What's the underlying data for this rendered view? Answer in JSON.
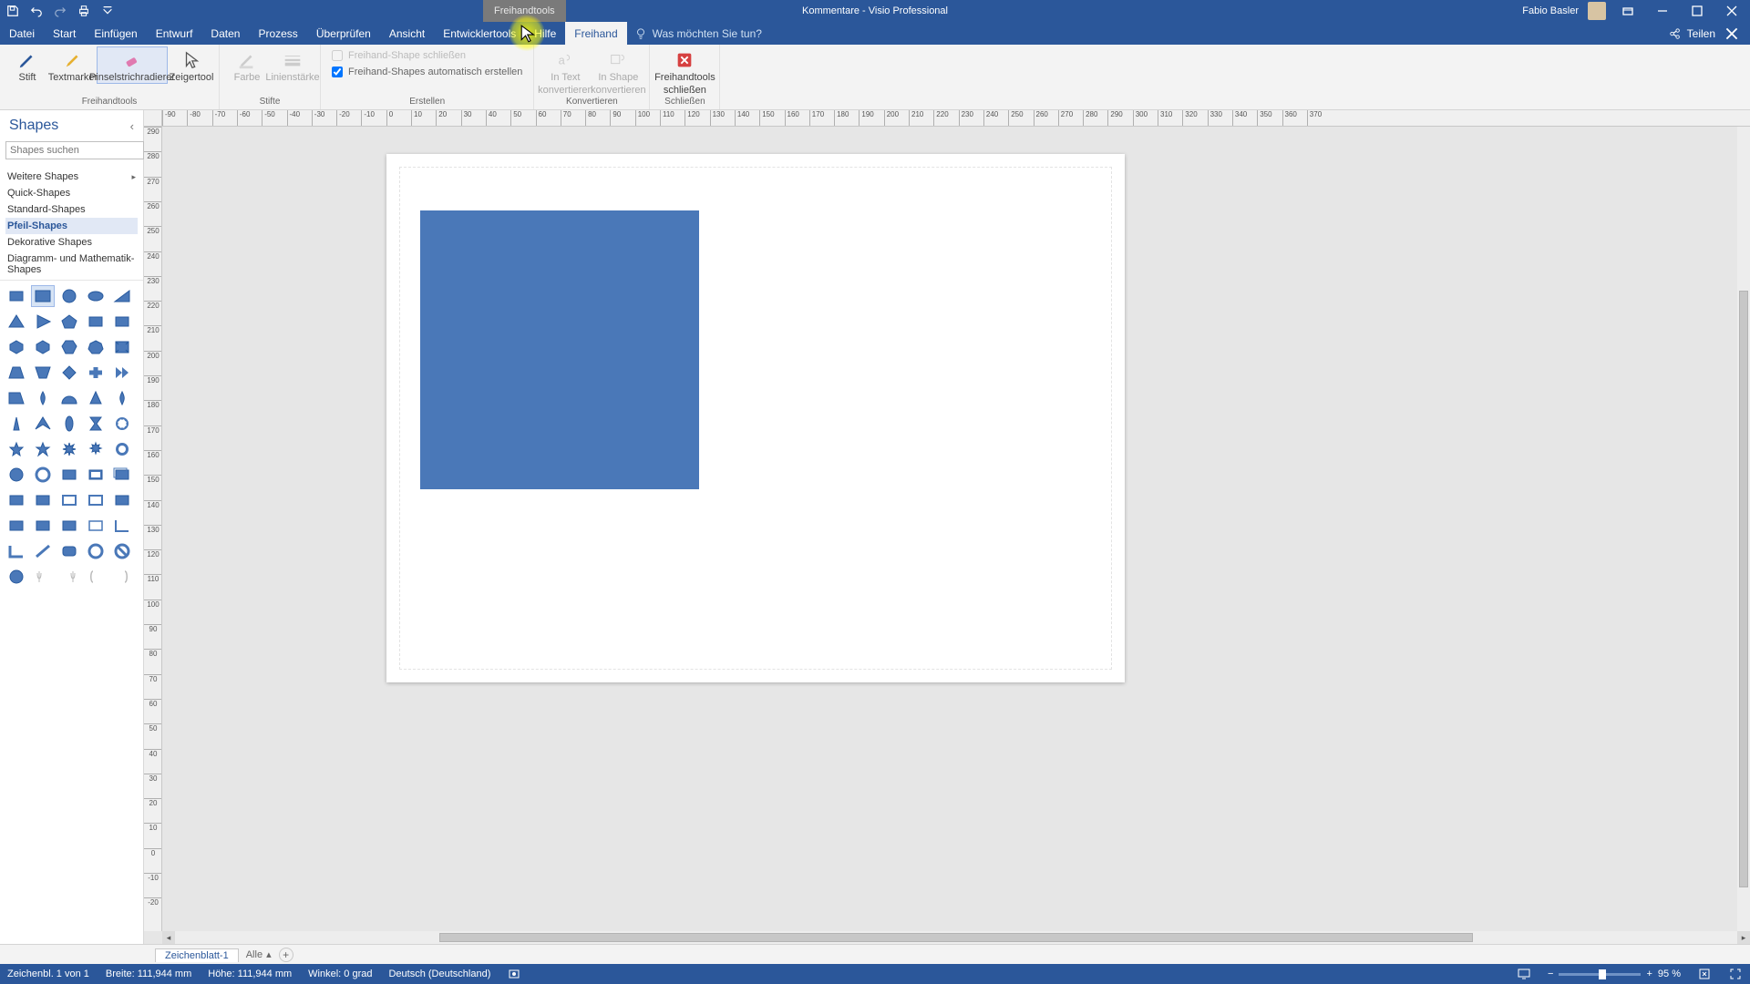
{
  "titlebar": {
    "context_tab": "Freihandtools",
    "doc": "Kommentare  -  Visio Professional",
    "user": "Fabio Basler"
  },
  "menu": {
    "tabs": [
      "Datei",
      "Start",
      "Einfügen",
      "Entwurf",
      "Daten",
      "Prozess",
      "Überprüfen",
      "Ansicht",
      "Entwicklertools",
      "Hilfe",
      "Freihand"
    ],
    "active_index": 10,
    "search_placeholder": "Was möchten Sie tun?",
    "share": "Teilen"
  },
  "ribbon": {
    "g1": {
      "btn1": "Stift",
      "btn2": "Textmarker",
      "btn3": "Pinselstrichradierer",
      "btn4": "Zeigertool",
      "label": "Freihandtools"
    },
    "g2": {
      "btn1": "Farbe",
      "btn2": "Linienstärke",
      "label": "Stifte"
    },
    "g3": {
      "opt1": "Freihand-Shape schließen",
      "opt2": "Freihand-Shapes automatisch erstellen",
      "label": "Erstellen"
    },
    "g4": {
      "btn1a": "In Text",
      "btn1b": "konvertieren",
      "btn2a": "In Shape",
      "btn2b": "konvertieren",
      "label": "Konvertieren"
    },
    "g5": {
      "btn1a": "Freihandtools",
      "btn1b": "schließen",
      "label": "Schließen"
    }
  },
  "shapes": {
    "title": "Shapes",
    "search_placeholder": "Shapes suchen",
    "cats": [
      {
        "label": "Weitere Shapes",
        "sub": true
      },
      {
        "label": "Quick-Shapes"
      },
      {
        "label": "Standard-Shapes"
      },
      {
        "label": "Pfeil-Shapes"
      },
      {
        "label": "Dekorative Shapes"
      },
      {
        "label": "Diagramm- und Mathematik-Shapes"
      }
    ],
    "selected_cat": 3
  },
  "ruler_h_start": -90,
  "ruler_h_end": 370,
  "ruler_h_step": 10,
  "ruler_v_start": 290,
  "ruler_v_end": -20,
  "ruler_v_step": 10,
  "sheettabs": {
    "tab1": "Zeichenblatt-1",
    "all": "Alle"
  },
  "status": {
    "page": "Zeichenbl. 1 von 1",
    "width": "Breite: 111,944 mm",
    "height": "Höhe: 111,944 mm",
    "angle": "Winkel: 0 grad",
    "lang": "Deutsch (Deutschland)",
    "zoom": "95 %"
  }
}
